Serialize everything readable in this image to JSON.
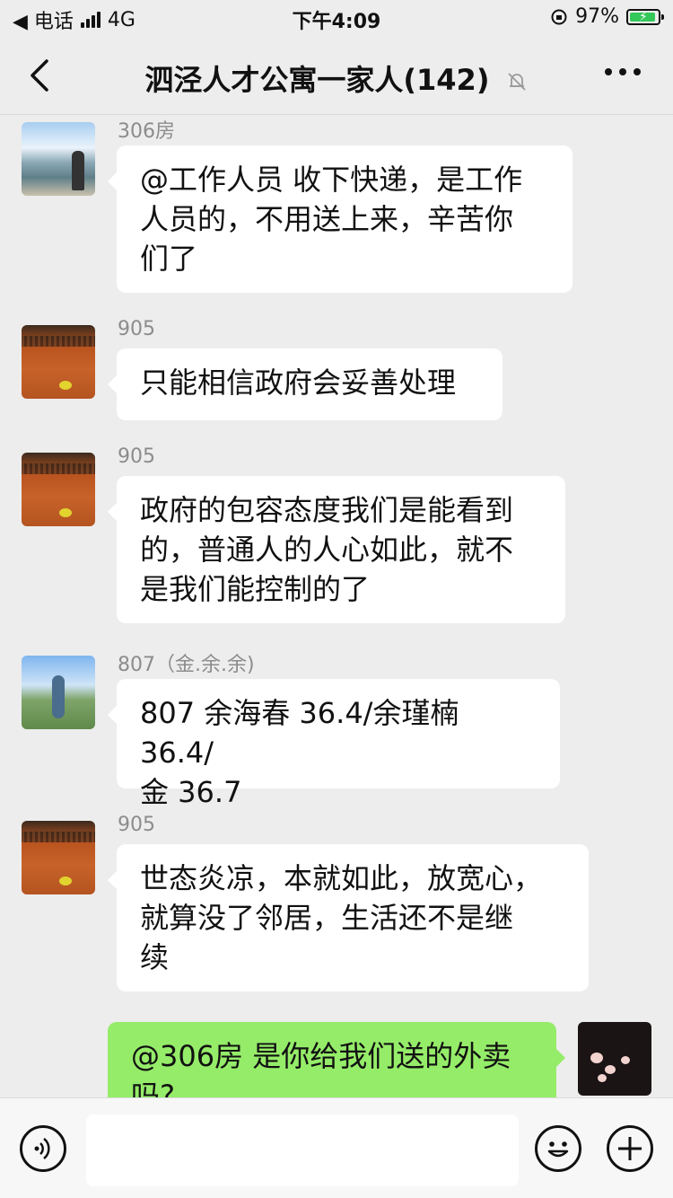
{
  "status_bar": {
    "carrier": "◀ 电话",
    "network": "4G",
    "time": "下午4:09",
    "battery": "97%"
  },
  "nav": {
    "title": "泗泾人才公寓一家人(142)"
  },
  "messages": [
    {
      "sender": "306房",
      "text": "@工作人员 收下快递，是工作人员的，不用送上来，辛苦你们了",
      "lines": [
        "@工作人员 收下快递，是工作",
        "人员的，不用送上来，辛苦你",
        "们了"
      ]
    },
    {
      "sender": "905",
      "lines": [
        "只能相信政府会妥善处理"
      ]
    },
    {
      "sender": "905",
      "lines": [
        "政府的包容态度我们是能看到",
        "的，普通人的人心如此，就不",
        "是我们能控制的了"
      ]
    },
    {
      "sender": "807（金.余.余)",
      "lines": [
        "807 余海春 36.4/余瑾楠 36.4/",
        "金 36.7"
      ]
    },
    {
      "sender": "905",
      "lines": [
        "世态炎凉，本就如此，放宽心，",
        "就算没了邻居，生活还不是继",
        "续"
      ]
    },
    {
      "sender": "",
      "lines": [
        "@306房 是你给我们送的外卖",
        "吗?"
      ]
    }
  ],
  "input": {
    "placeholder": ""
  },
  "icons": {
    "back": "chevron-left-icon",
    "mute": "bell-slash-icon",
    "more": "more-horizontal-icon",
    "voice": "voice-icon",
    "emoji": "smiley-icon",
    "plus": "plus-circle-icon"
  }
}
